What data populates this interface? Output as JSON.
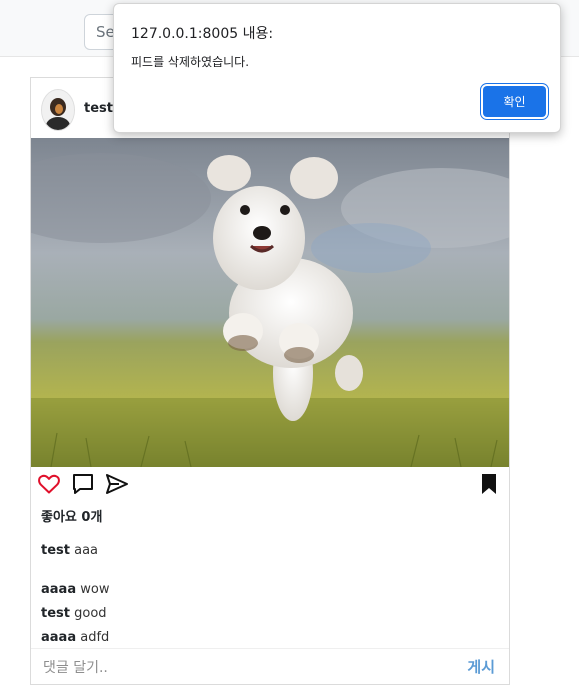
{
  "navbar": {
    "search_placeholder": "Search"
  },
  "feed": {
    "username": "test",
    "likes_text": "좋아요 0개",
    "caption": {
      "user": "test",
      "text": "aaa"
    },
    "comments": [
      {
        "user": "aaaa",
        "text": "wow"
      },
      {
        "user": "test",
        "text": "good"
      },
      {
        "user": "aaaa",
        "text": "adfd"
      }
    ],
    "comment_placeholder": "댓글 달기..",
    "post_label": "게시",
    "icons": {
      "like": "heart-icon",
      "comment": "comment-icon",
      "share": "send-icon",
      "save": "bookmark-icon"
    },
    "colors": {
      "heart": "#e0102b",
      "post_button": "#5b9bd5"
    }
  },
  "dialog": {
    "title": "127.0.0.1:8005 내용:",
    "message": "피드를 삭제하였습니다.",
    "ok_label": "확인",
    "accent": "#1a73e8"
  }
}
